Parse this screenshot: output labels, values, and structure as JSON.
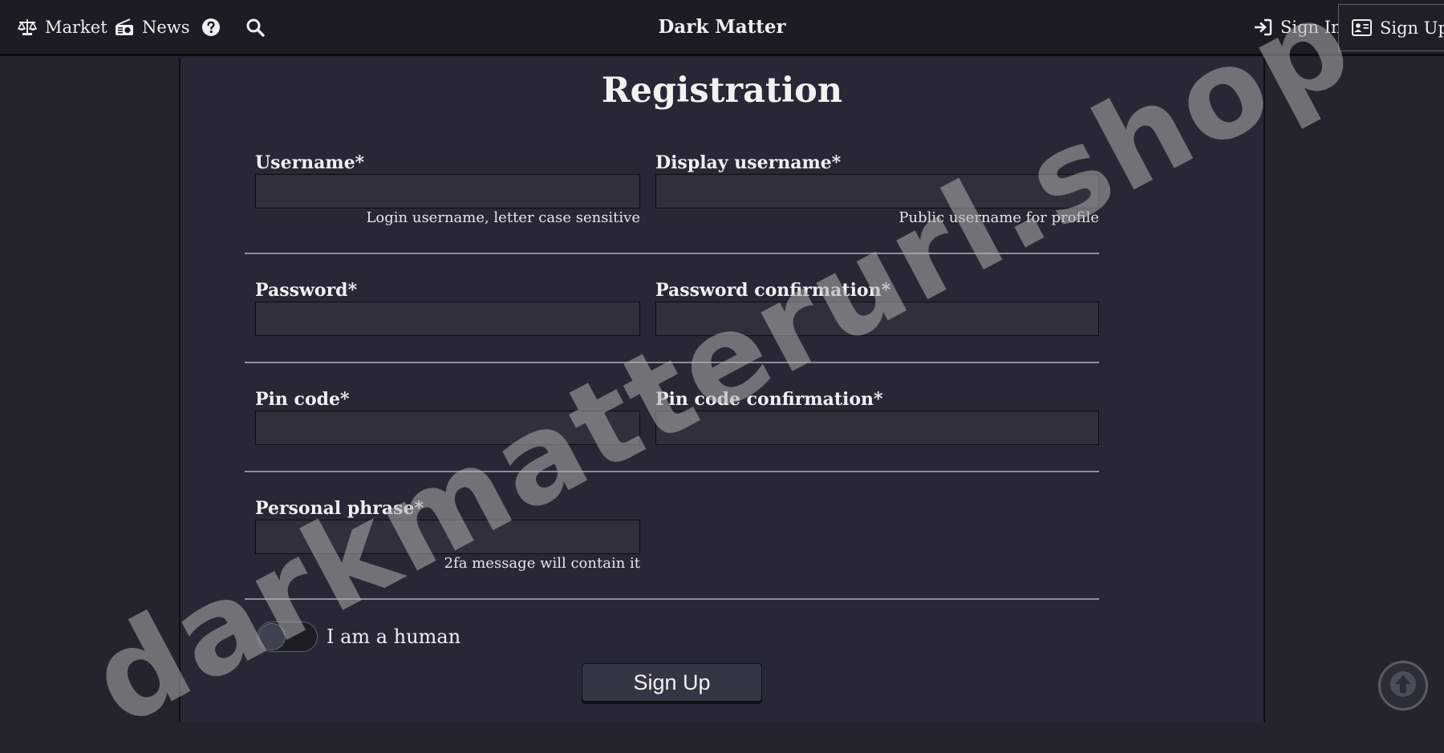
{
  "navbar": {
    "market_label": "Market",
    "news_label": "News",
    "brand": "Dark Matter",
    "signin_label": "Sign In",
    "signup_label": "Sign Up",
    "icons": [
      "balance-scale-icon",
      "radio-icon",
      "help-icon",
      "search-icon",
      "sign-in-icon",
      "id-card-icon"
    ]
  },
  "page": {
    "title": "Registration"
  },
  "form": {
    "username": {
      "label": "Username*",
      "value": "",
      "hint": "Login username, letter case sensitive"
    },
    "display_username": {
      "label": "Display username*",
      "value": "",
      "hint": "Public username for profile"
    },
    "password": {
      "label": "Password*",
      "value": ""
    },
    "password_confirmation": {
      "label": "Password confirmation*",
      "value": ""
    },
    "pin_code": {
      "label": "Pin code*",
      "value": ""
    },
    "pin_code_confirmation": {
      "label": "Pin code confirmation*",
      "value": ""
    },
    "personal_phrase": {
      "label": "Personal phrase*",
      "value": "",
      "hint": "2fa message will contain it"
    },
    "human_toggle": {
      "label": "I am a human",
      "checked": false
    },
    "submit_label": "Sign Up"
  },
  "watermark": "darkmatterurl.shop",
  "colors": {
    "background": "#23252e",
    "panel": "#262935",
    "navbar": "#1b1d24",
    "input": "#2e313c",
    "text": "#eceff4"
  }
}
